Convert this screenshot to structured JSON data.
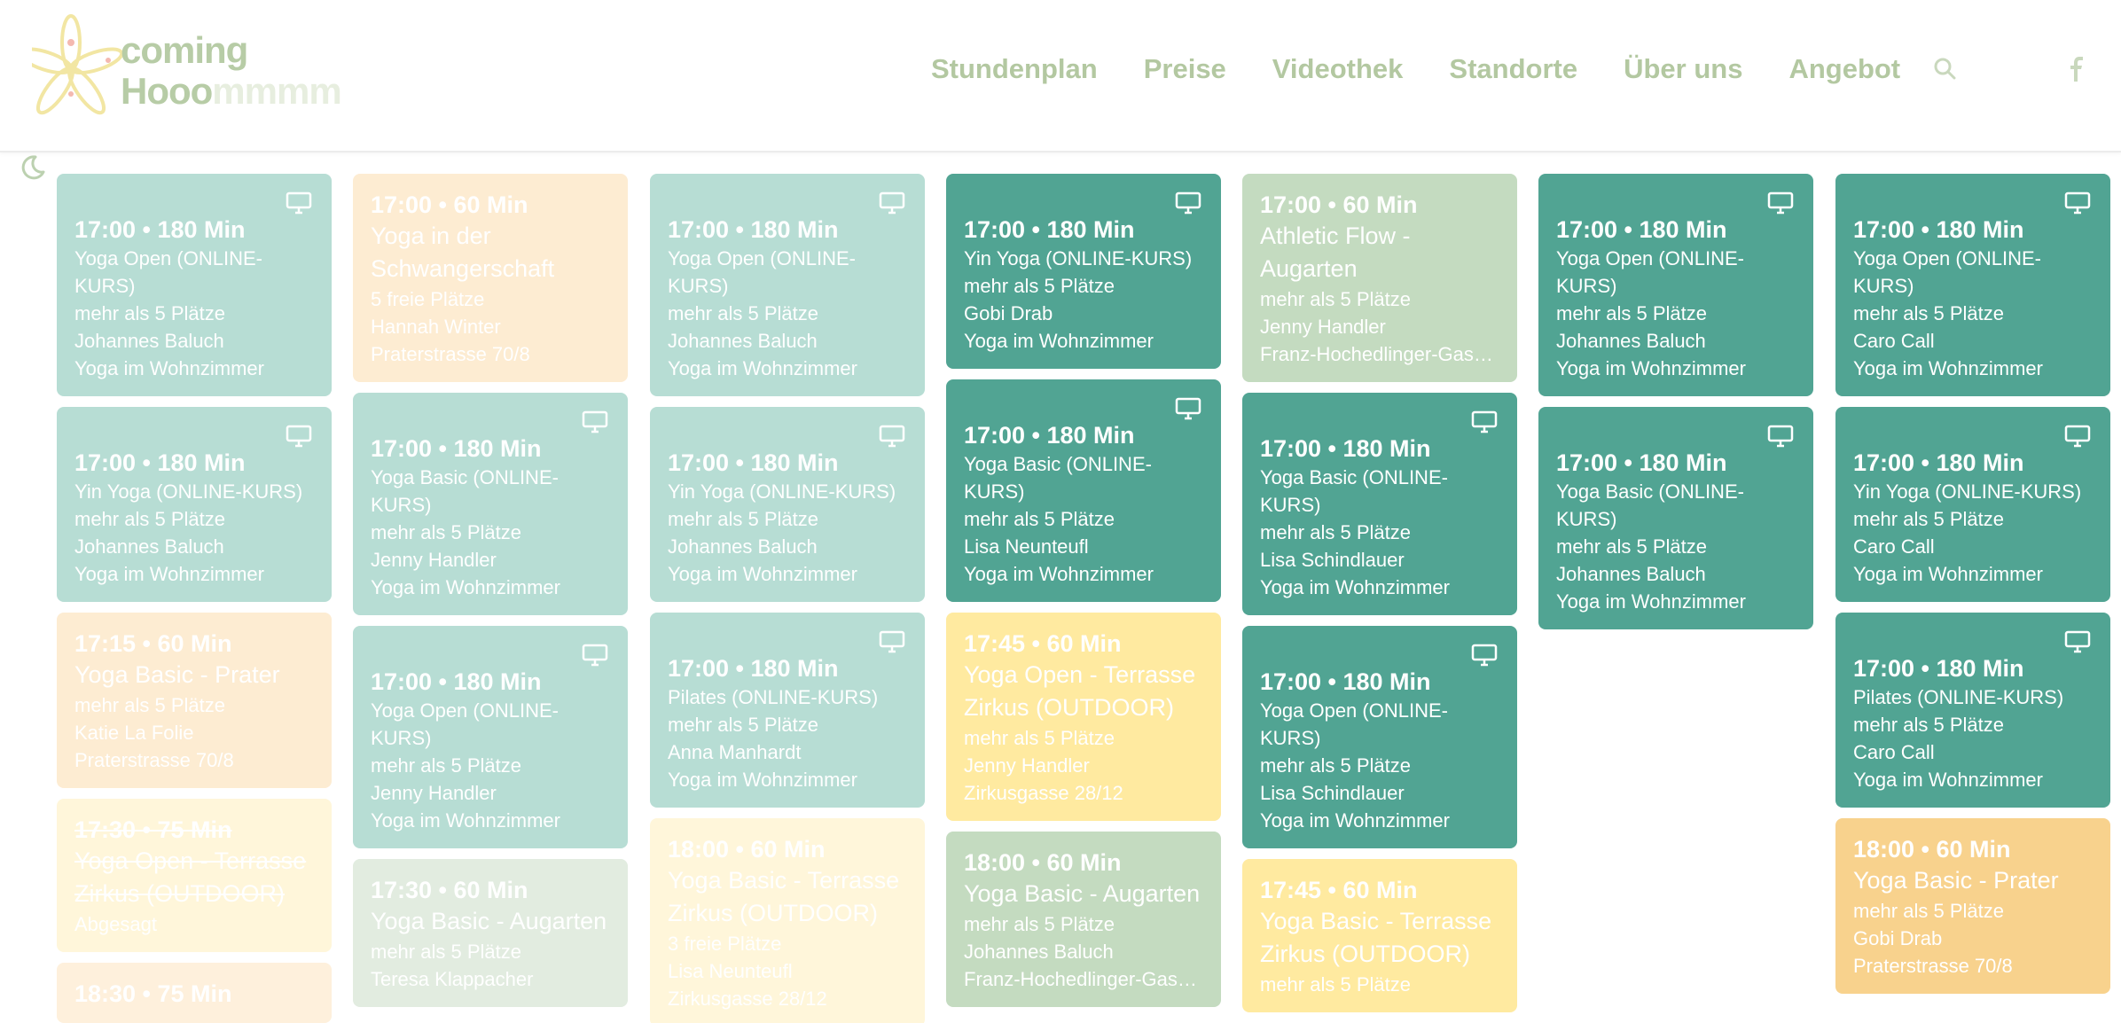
{
  "brand": {
    "line1": "coming",
    "line2": "Hooo",
    "line2_fade": "mmmm"
  },
  "nav": [
    "Stundenplan",
    "Preise",
    "Videothek",
    "Standorte",
    "Über uns",
    "Angebot"
  ],
  "icons": {
    "search": "search-icon",
    "facebook": "facebook-icon",
    "theme": "moon-icon",
    "online": "monitor-icon"
  },
  "colors": {
    "dark_teal": "#51a493",
    "pastel_teal": "#b7ddd4",
    "nav": "#b3c8a1"
  },
  "columns": [
    [
      {
        "time": "17:00 • 180 Min",
        "title": "Yoga Open (ONLINE-KURS)",
        "lines": [
          "mehr als 5 Plätze",
          "Johannes Baluch",
          "Yoga im Wohnzimmer"
        ],
        "style": "pastel-teal",
        "online": true
      },
      {
        "time": "17:00 • 180 Min",
        "title": "Yin Yoga (ONLINE-KURS)",
        "lines": [
          "mehr als 5 Plätze",
          "Johannes Baluch",
          "Yoga im Wohnzimmer"
        ],
        "style": "pastel-teal",
        "online": true
      },
      {
        "time": "17:15 • 60 Min",
        "title": "Yoga Basic - Prater",
        "lines": [
          "mehr als 5 Plätze",
          "Katie La Folie",
          "Praterstrasse 70/8"
        ],
        "style": "peach",
        "online": false
      },
      {
        "time": "17:30 • 75 Min",
        "title": "Yoga Open - Terrasse Zirkus (OUTDOOR)",
        "lines": [
          "Abgesagt"
        ],
        "style": "cream",
        "online": false,
        "cancelled": true
      },
      {
        "time": "18:30 • 75 Min",
        "title": "",
        "lines": [],
        "style": "peach-soft",
        "online": false
      }
    ],
    [
      {
        "time": "17:00 • 60 Min",
        "title": "Yoga in der Schwangerschaft",
        "lines": [
          "5 freie Plätze",
          "Hannah Winter",
          "Praterstrasse 70/8"
        ],
        "style": "peach",
        "online": false
      },
      {
        "time": "17:00 • 180 Min",
        "title": "Yoga Basic (ONLINE-KURS)",
        "lines": [
          "mehr als 5 Plätze",
          "Jenny Handler",
          "Yoga im Wohnzimmer"
        ],
        "style": "pastel-teal",
        "online": true
      },
      {
        "time": "17:00 • 180 Min",
        "title": "Yoga Open (ONLINE-KURS)",
        "lines": [
          "mehr als 5 Plätze",
          "Jenny Handler",
          "Yoga im Wohnzimmer"
        ],
        "style": "pastel-teal",
        "online": true
      },
      {
        "time": "17:30 • 60 Min",
        "title": "Yoga Basic - Augarten",
        "lines": [
          "mehr als 5 Plätze",
          "Teresa Klappacher"
        ],
        "style": "mint-soft",
        "online": false
      }
    ],
    [
      {
        "time": "17:00 • 180 Min",
        "title": "Yoga Open (ONLINE-KURS)",
        "lines": [
          "mehr als 5 Plätze",
          "Johannes Baluch",
          "Yoga im Wohnzimmer"
        ],
        "style": "pastel-teal",
        "online": true
      },
      {
        "time": "17:00 • 180 Min",
        "title": "Yin Yoga (ONLINE-KURS)",
        "lines": [
          "mehr als 5 Plätze",
          "Johannes Baluch",
          "Yoga im Wohnzimmer"
        ],
        "style": "pastel-teal",
        "online": true
      },
      {
        "time": "17:00 • 180 Min",
        "title": "Pilates (ONLINE-KURS)",
        "lines": [
          "mehr als 5 Plätze",
          "Anna Manhardt",
          "Yoga im Wohnzimmer"
        ],
        "style": "pastel-teal",
        "online": true
      },
      {
        "time": "18:00 • 60 Min",
        "title": "Yoga Basic - Terrasse Zirkus (OUTDOOR)",
        "lines": [
          "3 freie Plätze",
          "Lisa Neunteufl",
          "Zirkusgasse 28/12"
        ],
        "style": "cream",
        "online": false
      }
    ],
    [
      {
        "time": "17:00 • 180 Min",
        "title": "Yin Yoga (ONLINE-KURS)",
        "lines": [
          "mehr als 5 Plätze",
          "Gobi Drab",
          "Yoga im Wohnzimmer"
        ],
        "style": "dark-teal",
        "online": true
      },
      {
        "time": "17:00 • 180 Min",
        "title": "Yoga Basic (ONLINE-KURS)",
        "lines": [
          "mehr als 5 Plätze",
          "Lisa Neunteufl",
          "Yoga im Wohnzimmer"
        ],
        "style": "dark-teal",
        "online": true
      },
      {
        "time": "17:45 • 60 Min",
        "title": "Yoga Open - Terrasse Zirkus (OUTDOOR)",
        "lines": [
          "mehr als 5 Plätze",
          "Jenny Handler",
          "Zirkusgasse 28/12"
        ],
        "style": "yellow",
        "online": false
      },
      {
        "time": "18:00 • 60 Min",
        "title": "Yoga Basic - Augarten",
        "lines": [
          "mehr als 5 Plätze",
          "Johannes Baluch",
          "Franz-Hochedlinger-Gas…"
        ],
        "style": "mint",
        "online": false
      }
    ],
    [
      {
        "time": "17:00 • 60 Min",
        "title": "Athletic Flow - Augarten",
        "lines": [
          "mehr als 5 Plätze",
          "Jenny Handler",
          "Franz-Hochedlinger-Gas…"
        ],
        "style": "mint",
        "online": false
      },
      {
        "time": "17:00 • 180 Min",
        "title": "Yoga Basic (ONLINE-KURS)",
        "lines": [
          "mehr als 5 Plätze",
          "Lisa Schindlauer",
          "Yoga im Wohnzimmer"
        ],
        "style": "dark-teal",
        "online": true
      },
      {
        "time": "17:00 • 180 Min",
        "title": "Yoga Open (ONLINE-KURS)",
        "lines": [
          "mehr als 5 Plätze",
          "Lisa Schindlauer",
          "Yoga im Wohnzimmer"
        ],
        "style": "dark-teal",
        "online": true
      },
      {
        "time": "17:45 • 60 Min",
        "title": "Yoga Basic - Terrasse Zirkus (OUTDOOR)",
        "lines": [
          "mehr als 5 Plätze"
        ],
        "style": "yellow",
        "online": false
      }
    ],
    [
      {
        "time": "17:00 • 180 Min",
        "title": "Yoga Open (ONLINE-KURS)",
        "lines": [
          "mehr als 5 Plätze",
          "Johannes Baluch",
          "Yoga im Wohnzimmer"
        ],
        "style": "dark-teal",
        "online": true
      },
      {
        "time": "17:00 • 180 Min",
        "title": "Yoga Basic (ONLINE-KURS)",
        "lines": [
          "mehr als 5 Plätze",
          "Johannes Baluch",
          "Yoga im Wohnzimmer"
        ],
        "style": "dark-teal",
        "online": true
      }
    ],
    [
      {
        "time": "17:00 • 180 Min",
        "title": "Yoga Open (ONLINE-KURS)",
        "lines": [
          "mehr als 5 Plätze",
          "Caro Call",
          "Yoga im Wohnzimmer"
        ],
        "style": "dark-teal",
        "online": true
      },
      {
        "time": "17:00 • 180 Min",
        "title": "Yin Yoga (ONLINE-KURS)",
        "lines": [
          "mehr als 5 Plätze",
          "Caro Call",
          "Yoga im Wohnzimmer"
        ],
        "style": "dark-teal",
        "online": true
      },
      {
        "time": "17:00 • 180 Min",
        "title": "Pilates (ONLINE-KURS)",
        "lines": [
          "mehr als 5 Plätze",
          "Caro Call",
          "Yoga im Wohnzimmer"
        ],
        "style": "dark-teal",
        "online": true
      },
      {
        "time": "18:00 • 60 Min",
        "title": "Yoga Basic - Prater",
        "lines": [
          "mehr als 5 Plätze",
          "Gobi Drab",
          "Praterstrasse 70/8"
        ],
        "style": "orange",
        "online": false
      }
    ]
  ]
}
